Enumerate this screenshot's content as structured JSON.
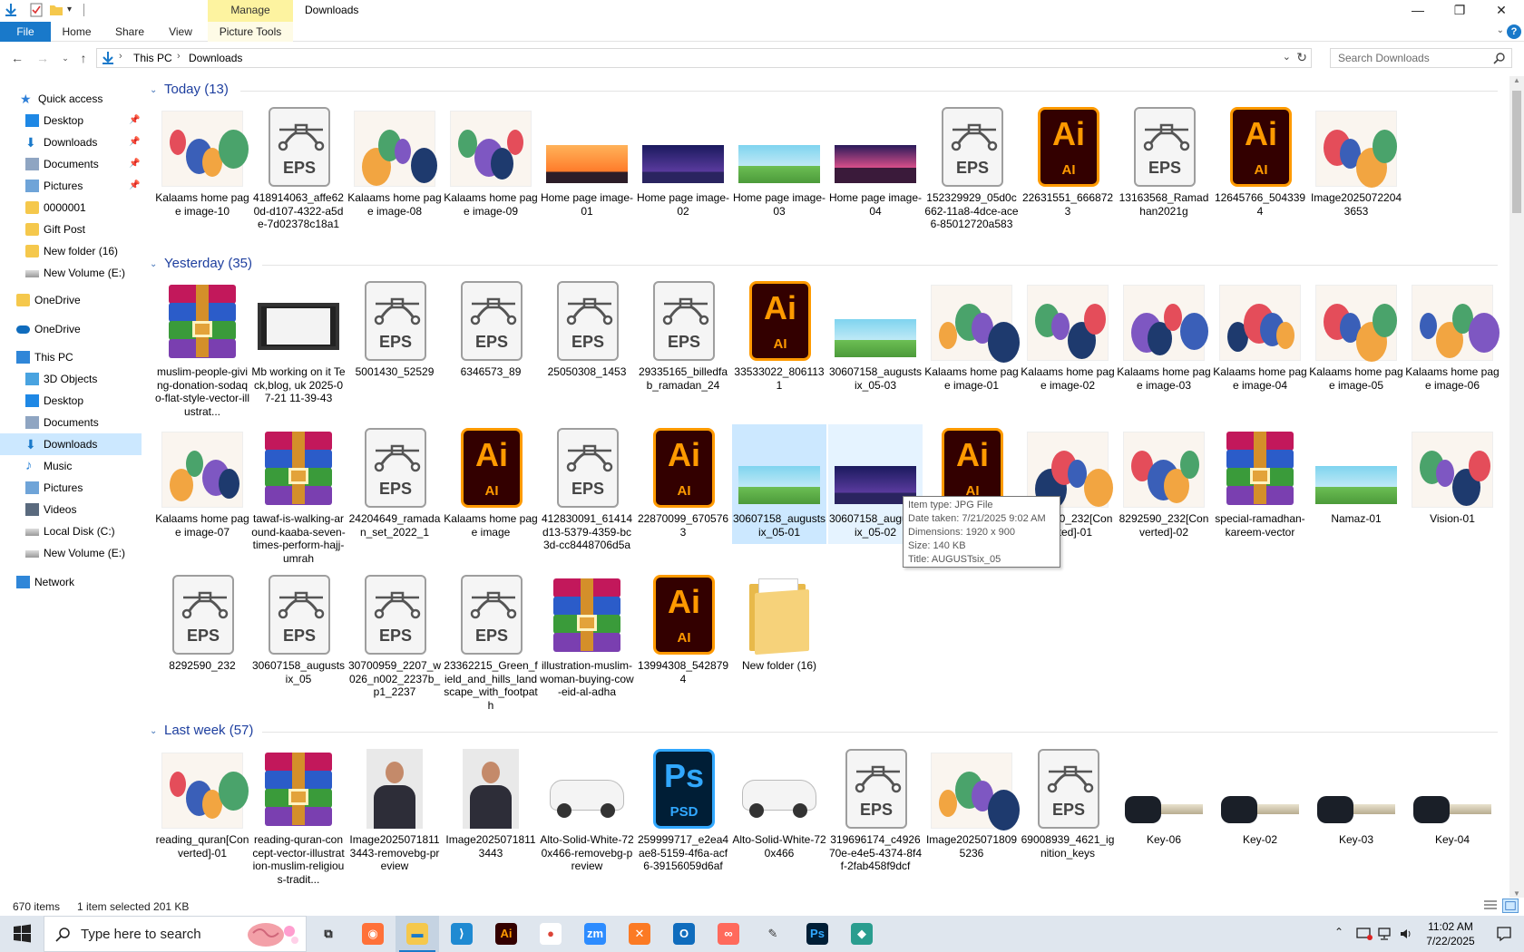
{
  "window": {
    "title": "Downloads",
    "manage_tab": "Manage",
    "controls": {
      "minimize": "—",
      "maximize": "❐",
      "close": "✕"
    }
  },
  "ribbon": {
    "file": "File",
    "tabs": [
      "Home",
      "Share",
      "View"
    ],
    "picture_tools": "Picture Tools"
  },
  "address": {
    "crumbs": [
      "This PC",
      "Downloads"
    ]
  },
  "search": {
    "placeholder": "Search Downloads"
  },
  "nav": [
    {
      "label": "Quick access",
      "icon": "star-icon",
      "pinned": false
    },
    {
      "label": "Desktop",
      "icon": "desktop-icon",
      "pinned": true
    },
    {
      "label": "Downloads",
      "icon": "download-icon",
      "pinned": true
    },
    {
      "label": "Documents",
      "icon": "documents-icon",
      "pinned": true
    },
    {
      "label": "Pictures",
      "icon": "pictures-icon",
      "pinned": true
    },
    {
      "label": "0000001",
      "icon": "folder-icon",
      "pinned": false
    },
    {
      "label": "Gift Post",
      "icon": "folder-icon",
      "pinned": false
    },
    {
      "label": "New folder (16)",
      "icon": "folder-icon",
      "pinned": false
    },
    {
      "label": "New Volume (E:)",
      "icon": "drive-icon",
      "pinned": false
    },
    {
      "label": "OneDrive",
      "icon": "folder-icon",
      "pinned": false
    },
    {
      "label": "OneDrive",
      "icon": "cloud-icon",
      "pinned": false
    },
    {
      "label": "This PC",
      "icon": "computer-icon",
      "pinned": false
    },
    {
      "label": "3D Objects",
      "icon": "3d-objects-icon",
      "pinned": false
    },
    {
      "label": "Desktop",
      "icon": "desktop-icon",
      "pinned": false
    },
    {
      "label": "Documents",
      "icon": "documents-icon",
      "pinned": false
    },
    {
      "label": "Downloads",
      "icon": "download-icon",
      "pinned": false
    },
    {
      "label": "Music",
      "icon": "music-icon",
      "pinned": false
    },
    {
      "label": "Pictures",
      "icon": "pictures-icon",
      "pinned": false
    },
    {
      "label": "Videos",
      "icon": "videos-icon",
      "pinned": false
    },
    {
      "label": "Local Disk (C:)",
      "icon": "drive-icon",
      "pinned": false
    },
    {
      "label": "New Volume (E:)",
      "icon": "drive-icon",
      "pinned": false
    },
    {
      "label": "Network",
      "icon": "network-icon",
      "pinned": false
    }
  ],
  "groups": [
    {
      "title": "Today (13)"
    },
    {
      "title": "Yesterday (35)"
    },
    {
      "title": "Last week (57)"
    }
  ],
  "files": {
    "today": [
      {
        "name": "Kalaams home page image-10",
        "kind": "illu"
      },
      {
        "name": "418914063_affe620d-d107-4322-a5de-7d02378c18a1",
        "kind": "eps"
      },
      {
        "name": "Kalaams home page image-08",
        "kind": "illu"
      },
      {
        "name": "Kalaams home page image-09",
        "kind": "illu"
      },
      {
        "name": "Home page image-01",
        "kind": "sky-orange"
      },
      {
        "name": "Home page image-02",
        "kind": "sky-purple"
      },
      {
        "name": "Home page image-03",
        "kind": "sky-green"
      },
      {
        "name": "Home page image-04",
        "kind": "sky-sunset"
      },
      {
        "name": "152329929_05d0c662-11a8-4dce-ace6-85012720a583",
        "kind": "eps"
      },
      {
        "name": "22631551_6668723",
        "kind": "ai"
      },
      {
        "name": "13163568_Ramadhan2021g",
        "kind": "eps"
      },
      {
        "name": "12645766_5043394",
        "kind": "ai"
      },
      {
        "name": "Image20250722043653",
        "kind": "illu"
      }
    ],
    "yesterday": [
      {
        "name": "muslim-people-giving-donation-sodaqo-flat-style-vector-illustrat...",
        "kind": "rar"
      },
      {
        "name": "Mb working on it Teck,blog, uk 2025-07-21 11-39-43",
        "kind": "video"
      },
      {
        "name": "5001430_52529",
        "kind": "eps"
      },
      {
        "name": "6346573_89",
        "kind": "eps"
      },
      {
        "name": "25050308_1453",
        "kind": "eps"
      },
      {
        "name": "29335165_billedfab_ramadan_24",
        "kind": "eps"
      },
      {
        "name": "33533022_8061131",
        "kind": "ai"
      },
      {
        "name": "30607158_augustsix_05-03",
        "kind": "sky-green"
      },
      {
        "name": "Kalaams home page image-01",
        "kind": "illu"
      },
      {
        "name": "Kalaams home page image-02",
        "kind": "illu"
      },
      {
        "name": "Kalaams home page image-03",
        "kind": "illu"
      },
      {
        "name": "Kalaams home page image-04",
        "kind": "illu"
      },
      {
        "name": "Kalaams home page image-05",
        "kind": "illu"
      },
      {
        "name": "Kalaams home page image-06",
        "kind": "illu"
      },
      {
        "name": "Kalaams home page image-07",
        "kind": "illu"
      },
      {
        "name": "tawaf-is-walking-around-kaaba-seven-times-perform-hajj-umrah",
        "kind": "rar"
      },
      {
        "name": "24204649_ramadan_set_2022_1",
        "kind": "eps"
      },
      {
        "name": "Kalaams home page image",
        "kind": "ai"
      },
      {
        "name": "412830091_61414d13-5379-4359-bc3d-cc8448706d5a",
        "kind": "eps"
      },
      {
        "name": "22870099_6705763",
        "kind": "ai"
      },
      {
        "name": "30607158_augustsix_05-01",
        "kind": "sky-green",
        "state": "selected"
      },
      {
        "name": "30607158_augustsix_05-02",
        "kind": "sky-purple",
        "state": "hovered"
      },
      {
        "name": "",
        "kind": "ai"
      },
      {
        "name": "8292590_232[Converted]-01",
        "kind": "illu"
      },
      {
        "name": "8292590_232[Converted]-02",
        "kind": "illu"
      },
      {
        "name": "special-ramadhan-kareem-vector",
        "kind": "rar"
      },
      {
        "name": "Namaz-01",
        "kind": "sky-green"
      },
      {
        "name": "Vision-01",
        "kind": "illu"
      },
      {
        "name": "8292590_232",
        "kind": "eps"
      },
      {
        "name": "30607158_augustsix_05",
        "kind": "eps"
      },
      {
        "name": "30700959_2207_w026_n002_2237b_p1_2237",
        "kind": "eps"
      },
      {
        "name": "23362215_Green_field_and_hills_landscape_with_footpath",
        "kind": "eps"
      },
      {
        "name": "illustration-muslim-woman-buying-cow-eid-al-adha",
        "kind": "rar"
      },
      {
        "name": "13994308_5428794",
        "kind": "ai"
      },
      {
        "name": "New folder (16)",
        "kind": "folder"
      }
    ],
    "lastweek": [
      {
        "name": "reading_quran[Converted]-01",
        "kind": "illu"
      },
      {
        "name": "reading-quran-concept-vector-illustration-muslim-religious-tradit...",
        "kind": "rar"
      },
      {
        "name": "Image20250718113443-removebg-preview",
        "kind": "photo"
      },
      {
        "name": "Image20250718113443",
        "kind": "photo"
      },
      {
        "name": "Alto-Solid-White-720x466-removebg-preview",
        "kind": "car"
      },
      {
        "name": "259999717_e2ea4ae8-5159-4f6a-acf6-39156059d6af",
        "kind": "psd"
      },
      {
        "name": "Alto-Solid-White-720x466",
        "kind": "car"
      },
      {
        "name": "319696174_c492670e-e4e5-4374-8f4f-2fab458f9dcf",
        "kind": "eps"
      },
      {
        "name": "Image20250718095236",
        "kind": "illu"
      },
      {
        "name": "69008939_4621_ignition_keys",
        "kind": "eps"
      },
      {
        "name": "Key-06",
        "kind": "key"
      },
      {
        "name": "Key-02",
        "kind": "key"
      },
      {
        "name": "Key-03",
        "kind": "key"
      },
      {
        "name": "Key-04",
        "kind": "key"
      }
    ]
  },
  "tooltip": [
    "Item type: JPG File",
    "Date taken: 7/21/2025 9:02 AM",
    "Dimensions: 1920 x 900",
    "Size: 140 KB",
    "Title: AUGUSTsix_05"
  ],
  "status": {
    "items": "670 items",
    "selected": "1 item selected  201 KB"
  },
  "taskbar": {
    "search_placeholder": "Type here to search",
    "apps": [
      {
        "name": "task-view",
        "glyph": "⧉"
      },
      {
        "name": "firefox",
        "glyph": "◉"
      },
      {
        "name": "file-explorer",
        "glyph": "▬"
      },
      {
        "name": "vscode",
        "glyph": "⟩"
      },
      {
        "name": "illustrator",
        "glyph": "Ai"
      },
      {
        "name": "chrome",
        "glyph": "●"
      },
      {
        "name": "zoom",
        "glyph": "zm"
      },
      {
        "name": "xampp",
        "glyph": "✕"
      },
      {
        "name": "outlook",
        "glyph": "O"
      },
      {
        "name": "creative-cloud",
        "glyph": "∞"
      },
      {
        "name": "pen-tool",
        "glyph": "✎"
      },
      {
        "name": "photoshop",
        "glyph": "Ps"
      },
      {
        "name": "app-diamond",
        "glyph": "◆"
      }
    ],
    "time": "11:02 AM",
    "date": "7/22/2025"
  },
  "colors": {
    "accent": "#1979ca",
    "selection": "#cce8ff",
    "group_title": "#1e3f9f",
    "manage": "#fdf3a0"
  }
}
